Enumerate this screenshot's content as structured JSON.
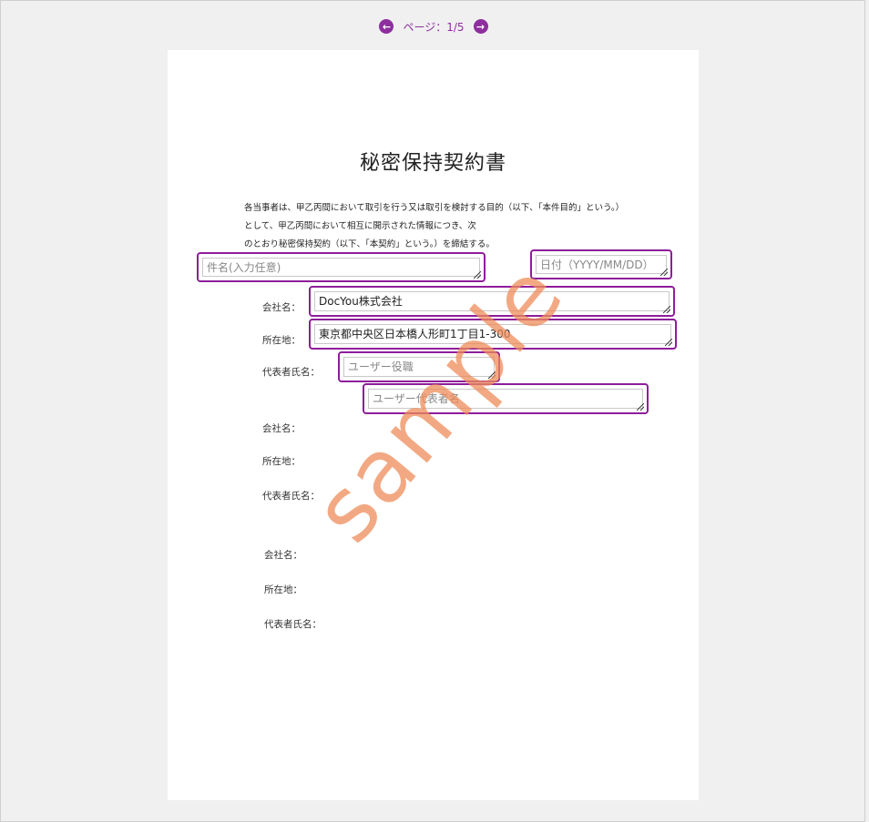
{
  "pager": {
    "label": "ページ：1/5",
    "prev_icon": "arrow-left-circle-icon",
    "next_icon": "arrow-right-circle-icon",
    "accent": "#8e2f9e"
  },
  "document": {
    "title": "秘密保持契約書",
    "intro_lines": [
      "各当事者は、甲乙丙間において取引を行う又は取引を検討する目的（以下、「本件目的」という。）",
      "として、甲乙丙間において相互に開示された情報につき、次",
      "のとおり秘密保持契約（以下、「本契約」という。）を締結する。"
    ],
    "watermark": "sample"
  },
  "fields": {
    "subject_placeholder": "件名(入力任意)",
    "date_placeholder": "日付（YYYY/MM/DD）",
    "company_value": "DocYou株式会社",
    "address_value": "東京都中央区日本橋人形町1丁目1-300",
    "role_placeholder": "ユーザー役職",
    "rep_placeholder": "ユーザー代表者名"
  },
  "labels": {
    "company": "会社名：",
    "address": "所在地：",
    "representative": "代表者氏名："
  },
  "colors": {
    "field_border": "#8e1d9a",
    "watermark": "#ee8c5a",
    "background": "#f0f0f0"
  }
}
